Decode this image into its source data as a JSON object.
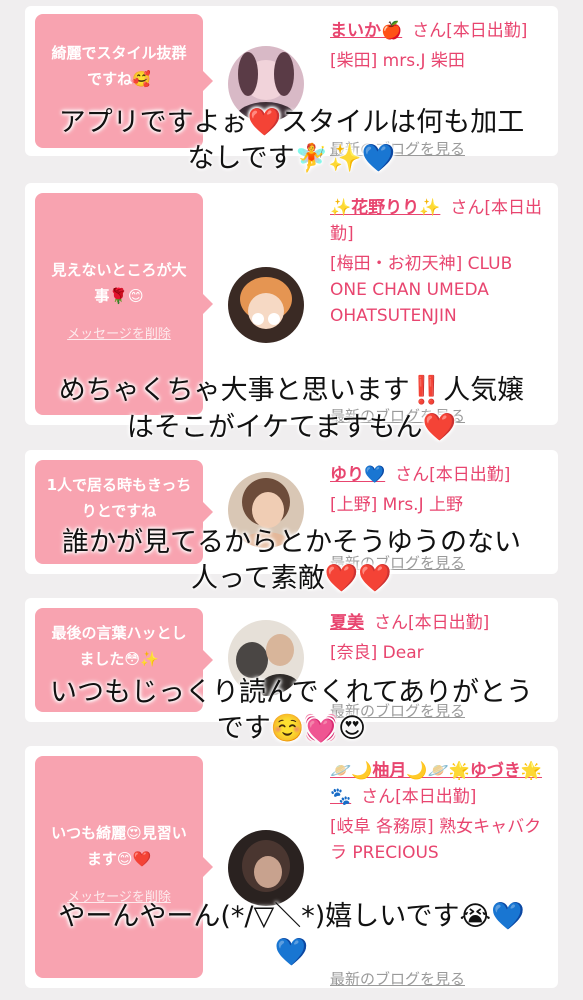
{
  "cards": [
    {
      "message": "綺麗でスタイル抜群ですね🥰",
      "delete_label": "",
      "name": "まいか🍎",
      "suffix": "さん[本日出勤]",
      "shop": "[柴田] mrs.J 柴田",
      "blog": "最新のブログを見る",
      "avatar_color": "#c9a6b4",
      "overlay": [
        "アプリですよぉ❤️スタイルは何も加工",
        "なしです🧚✨💙"
      ]
    },
    {
      "message": "見えないところが大事🌹😊",
      "delete_label": "メッセージを削除",
      "name": "✨花野りり✨",
      "suffix": "さん[本日出勤]",
      "shop": "[梅田・お初天神] CLUB ONE CHAN UMEDA OHATSUTENJIN",
      "blog": "最新のブログを見る",
      "avatar_color": "#e8a06a",
      "overlay": [
        "めちゃくちゃ大事と思います‼️人気嬢",
        "はそこがイケてますもん❤️"
      ]
    },
    {
      "message": "1人で居る時もきっちりとですね",
      "delete_label": "",
      "name": "ゆり💙",
      "suffix": "さん[本日出勤]",
      "shop": "[上野] Mrs.J 上野",
      "blog": "最新のブログを見る",
      "avatar_color": "#b98f73",
      "overlay": [
        "誰かが見てるからとかそうゆうのない",
        "人って素敵❤️❤️"
      ]
    },
    {
      "message": "最後の言葉ハッとしました😳✨",
      "delete_label": "",
      "name": "夏美",
      "suffix": "さん[本日出勤]",
      "shop": "[奈良] Dear",
      "blog": "最新のブログを見る",
      "avatar_color": "#a9a29c",
      "overlay": [
        "いつもじっくり読んでくれてありがとう",
        "です☺️💓😍"
      ]
    },
    {
      "message": "いつも綺麗😍見習います😊❤️",
      "delete_label": "メッセージを削除",
      "name": "🪐🌙柚月🌙🪐🌟ゆづき🌟🐾",
      "suffix": "さん[本日出勤]",
      "shop": "[岐阜 各務原] 熟女キャバクラ PRECIOUS",
      "blog": "最新のブログを見る",
      "avatar_color": "#5a4a44",
      "overlay": [
        "やーんやーん(*/▽＼*)嬉しいです😭💙",
        "💙"
      ]
    }
  ]
}
